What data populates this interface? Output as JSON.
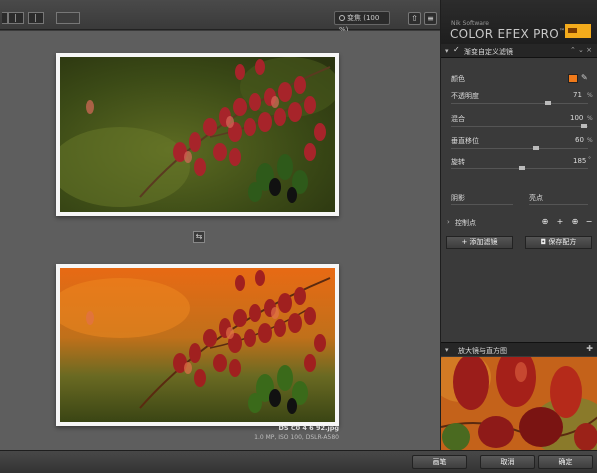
{
  "toolbar": {
    "zoom_label": "变焦 (100 %)",
    "nav_icon": "arrow-up-icon",
    "settings_icon": "sliders-icon"
  },
  "canvas": {
    "split_icon": "⇆",
    "caption_filename": "DS C0 4 6 92.jpg",
    "caption_info": "1.0 MP, ISO 100, DSLR-A580"
  },
  "brand": {
    "small": "Nik Software",
    "title": "COLOR EFEX PRO",
    "tm": "™",
    "version": "4"
  },
  "filter": {
    "name": "渐变自定义滤镜",
    "tools": "⌃ ⌄ ×",
    "color_label": "颜色",
    "color_value": "#f07a1a",
    "opacity_label": "不透明度",
    "opacity_value": "71",
    "blend_label": "混合",
    "blend_value": "100",
    "vertical_shift_label": "垂直移位",
    "vertical_shift_value": "60",
    "rotation_label": "旋转",
    "rotation_value": "185",
    "shadows_label": "阴影",
    "highlights_label": "亮点",
    "percent": "%",
    "degree": "°",
    "control_points_label": "控制点"
  },
  "panel_buttons": {
    "add_filter": "添加滤镜",
    "save_recipe": "保存配方"
  },
  "loupe": {
    "label": "放大镜与直方图"
  },
  "bottom": {
    "brush": "画笔",
    "cancel": "取消",
    "ok": "确定"
  },
  "colors": {
    "accent": "#f3ab1c",
    "swatch": "#f07a1a"
  }
}
